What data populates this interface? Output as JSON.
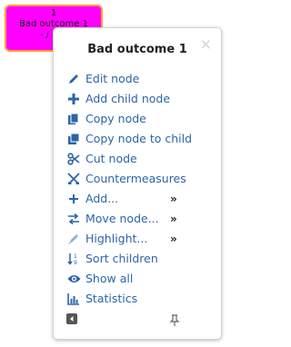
{
  "node": {
    "number": "1",
    "line1": "Bad outcome 1",
    "line2": "- / - / -"
  },
  "popup": {
    "title": "Bad outcome 1",
    "close": "×",
    "items": [
      {
        "label": "Edit node",
        "icon": "pencil-icon"
      },
      {
        "label": "Add child node",
        "icon": "plus-icon"
      },
      {
        "label": "Copy node",
        "icon": "copy-icon"
      },
      {
        "label": "Copy node to child",
        "icon": "copy-to-child-icon"
      },
      {
        "label": "Cut node",
        "icon": "scissors-icon"
      },
      {
        "label": "Countermeasures",
        "icon": "countermeasures-icon"
      },
      {
        "label": "Add...",
        "icon": "add-submenu-icon",
        "submenu": "»"
      },
      {
        "label": "Move node...",
        "icon": "move-arrows-icon",
        "submenu": "»"
      },
      {
        "label": "Highlight...",
        "icon": "highlighter-icon",
        "submenu": "»"
      },
      {
        "label": "Sort children",
        "icon": "sort-icon"
      },
      {
        "label": "Show all",
        "icon": "eye-icon"
      },
      {
        "label": "Statistics",
        "icon": "chart-icon"
      }
    ]
  },
  "colors": {
    "node_fill": "#ff00ff",
    "node_border": "#ff9b2e",
    "link": "#2b65a8"
  }
}
